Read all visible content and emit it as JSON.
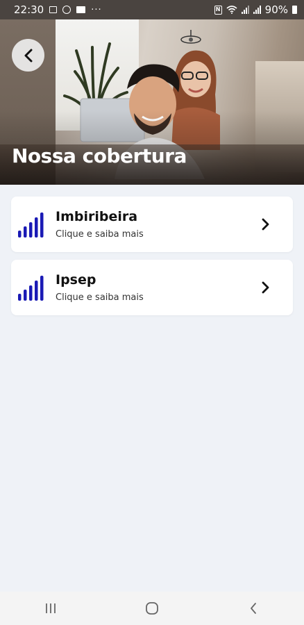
{
  "status_bar": {
    "time": "22:30",
    "battery_text": "90%",
    "left_icons": [
      "gallery-icon",
      "whatsapp-icon",
      "message-icon",
      "more-dots-icon"
    ],
    "right_icons": [
      "nfc-icon",
      "wifi-icon",
      "signal-icon",
      "signal-icon",
      "battery-icon"
    ]
  },
  "header": {
    "title": "Nossa cobertura",
    "back_icon": "chevron-left-icon"
  },
  "coverage": {
    "items": [
      {
        "title": "Imbiribeira",
        "subtitle": "Clique e saiba mais",
        "icon": "signal-bars-icon"
      },
      {
        "title": "Ipsep",
        "subtitle": "Clique e saiba mais",
        "icon": "signal-bars-icon"
      }
    ]
  },
  "colors": {
    "accent": "#1a1ab5",
    "background": "#eff2f7",
    "card": "#ffffff"
  },
  "nav_bar": {
    "buttons": [
      "recent-apps-icon",
      "home-icon",
      "back-icon"
    ]
  }
}
